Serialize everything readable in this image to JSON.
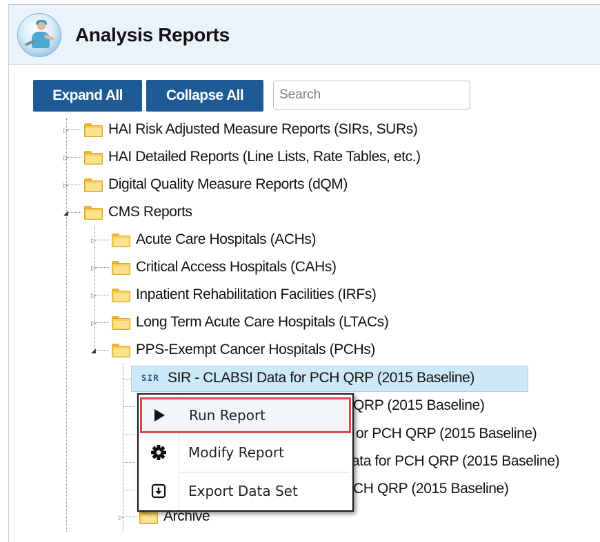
{
  "header": {
    "title": "Analysis Reports",
    "logo_icon": "analysis-reports-logo-icon"
  },
  "toolbar": {
    "expand_all_label": "Expand All",
    "collapse_all_label": "Collapse All",
    "search_placeholder": "Search",
    "button_color": "#1e5b95"
  },
  "tree": {
    "folders": [
      {
        "label": "HAI Risk Adjusted Measure Reports (SIRs, SURs)",
        "expanded": false
      },
      {
        "label": "HAI Detailed Reports (Line Lists, Rate Tables, etc.)",
        "expanded": false
      },
      {
        "label": "Digital Quality Measure Reports (dQM)",
        "expanded": false
      },
      {
        "label": "CMS Reports",
        "expanded": true
      }
    ],
    "cms_children": [
      {
        "label": "Acute Care Hospitals (ACHs)",
        "expanded": false
      },
      {
        "label": "Critical Access Hospitals (CAHs)",
        "expanded": false
      },
      {
        "label": "Inpatient Rehabilitation Facilities (IRFs)",
        "expanded": false
      },
      {
        "label": "Long Term Acute Care Hospitals (LTACs)",
        "expanded": false
      },
      {
        "label": "PPS-Exempt Cancer Hospitals (PCHs)",
        "expanded": true
      }
    ],
    "pch_reports": [
      {
        "label": "SIR - CLABSI Data for PCH QRP (2015 Baseline)",
        "icon_text": "SIR",
        "selected": true
      },
      {
        "label": "QRP (2015 Baseline)"
      },
      {
        "label": "or PCH QRP (2015 Baseline)"
      },
      {
        "label": "ata for PCH QRP (2015 Baseline)"
      },
      {
        "label": "CH QRP (2015 Baseline)"
      }
    ],
    "archive_label": "Archive"
  },
  "context_menu": {
    "items": [
      {
        "label": "Run Report",
        "icon": "play-icon",
        "highlighted": true
      },
      {
        "label": "Modify Report",
        "icon": "gear-icon"
      },
      {
        "label": "Export Data Set",
        "icon": "download-icon"
      }
    ],
    "highlight_color": "#d94a4a"
  }
}
